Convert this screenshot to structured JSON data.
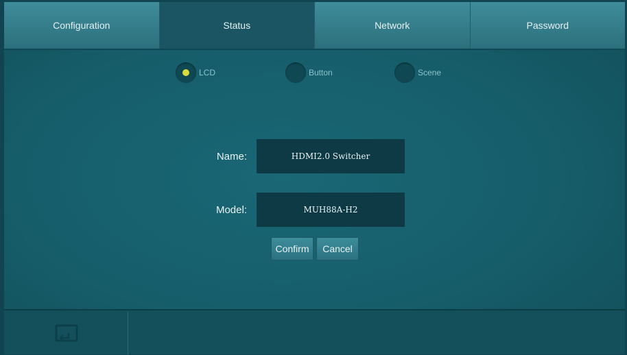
{
  "tabs": [
    {
      "label": "Configuration",
      "active": false
    },
    {
      "label": "Status",
      "active": true
    },
    {
      "label": "Network",
      "active": false
    },
    {
      "label": "Password",
      "active": false
    }
  ],
  "options": [
    {
      "label": "LCD",
      "selected": true
    },
    {
      "label": "Button",
      "selected": false
    },
    {
      "label": "Scene",
      "selected": false
    }
  ],
  "form": {
    "name_label": "Name:",
    "name_value": "HDMI2.0 Switcher",
    "model_label": "Model:",
    "model_value": "MUH88A-H2"
  },
  "buttons": {
    "confirm": "Confirm",
    "cancel": "Cancel"
  },
  "footer": {
    "back_icon": "return-screen-icon"
  },
  "colors": {
    "background": "#165d6a",
    "active_tab": "#1b5563",
    "selected_dot": "#d8dc3c"
  }
}
